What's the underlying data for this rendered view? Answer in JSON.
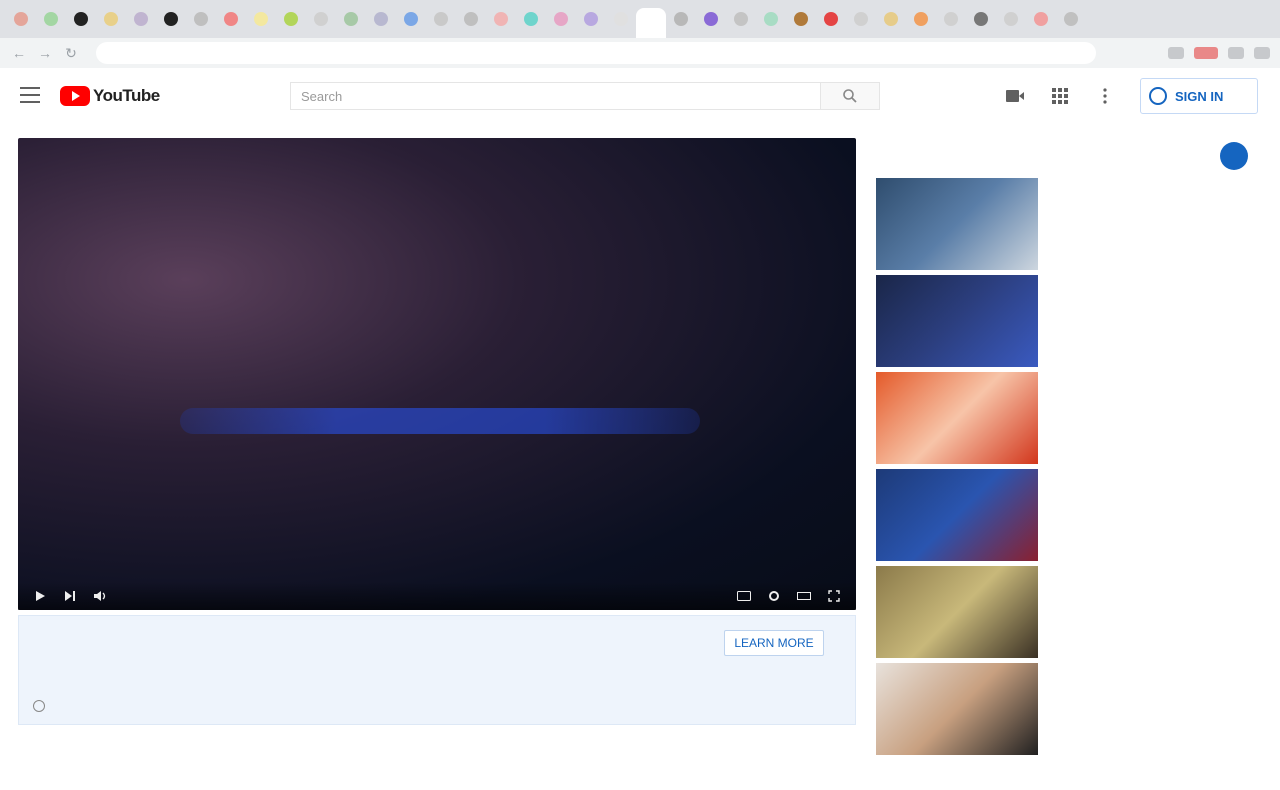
{
  "browser": {
    "tab_favicon_colors": [
      "#e4a59a",
      "#a3d6a3",
      "#222222",
      "#e8d08a",
      "#c0b4d0",
      "#222222",
      "#bfbfbf",
      "#f08686",
      "#f3e8a0",
      "#b2d55a",
      "#d0d0d0",
      "#a7c9a7",
      "#b8b8d0",
      "#7ba7e6",
      "#c9c9c9",
      "#bfbfbf",
      "#f0b4b4",
      "#6fd4cc",
      "#e6a6c6",
      "#b8a8e0",
      "#e0e0e0",
      "#b8b8b8",
      "#8a6ad6",
      "#c4c4c4",
      "#a8dcc4",
      "#b07a3a",
      "#e44444",
      "#d0d0d0",
      "#e6cc8a",
      "#f0a060",
      "#d0d0d0",
      "#777777",
      "#d0d0d0",
      "#f0a0a0",
      "#c0c0c0"
    ],
    "url": "",
    "nav_icons": [
      "back-icon",
      "forward-icon",
      "reload-icon"
    ]
  },
  "header": {
    "logo_text": "YouTube",
    "logo_region": "",
    "search_placeholder": "Search",
    "sign_in_label": "SIGN IN"
  },
  "player": {
    "brand_text": "",
    "sub_text": "",
    "bar_text": "",
    "cta_text": "",
    "time_text": ""
  },
  "ad": {
    "title": "",
    "description": "",
    "link_text": "",
    "learn_more_label": "LEARN MORE"
  },
  "description": {
    "text": "",
    "meta": []
  },
  "sidebar": {
    "up_next_label": "",
    "autoplay_label": "",
    "items": [
      {
        "title": "",
        "channel": "",
        "views": "",
        "thumb_colors": [
          "#2f4d6e",
          "#5a7ea8",
          "#cdd6df"
        ]
      },
      {
        "title": "",
        "channel": "",
        "views": "",
        "thumb_colors": [
          "#1a2648",
          "#2c3f80",
          "#3a5ac0"
        ]
      },
      {
        "title": "",
        "channel": "",
        "views": "",
        "thumb_colors": [
          "#e45a2a",
          "#f7c4a8",
          "#d2361c"
        ]
      },
      {
        "title": "",
        "channel": "",
        "views": "",
        "thumb_colors": [
          "#1d3a78",
          "#2a55b0",
          "#8a2030"
        ]
      },
      {
        "title": "",
        "channel": "",
        "views": "",
        "thumb_colors": [
          "#8b7a4a",
          "#c8b87a",
          "#3a3024"
        ]
      },
      {
        "title": "",
        "channel": "",
        "views": "",
        "thumb_colors": [
          "#e8e2dc",
          "#c8a080",
          "#202020"
        ]
      }
    ]
  },
  "colors": {
    "brand_red": "#ff0000",
    "link_blue": "#1565c0",
    "ad_panel_bg": "#eef4fc"
  }
}
